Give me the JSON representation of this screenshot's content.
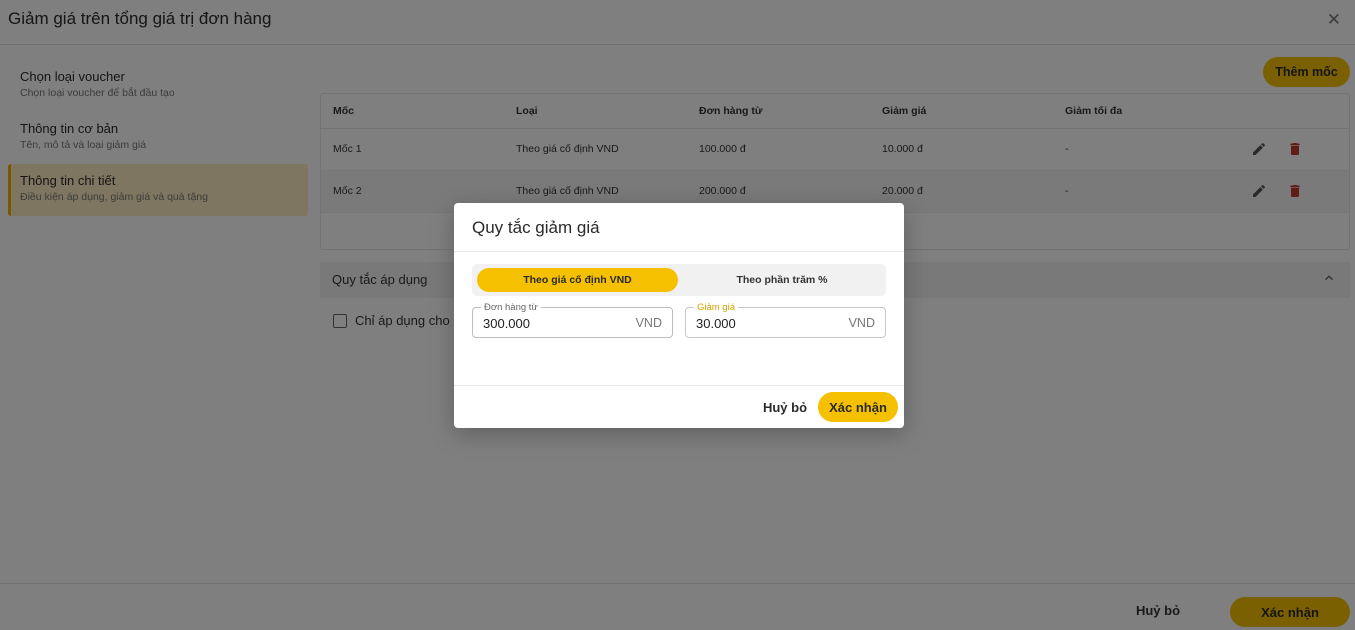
{
  "header": {
    "title": "Giảm giá trên tổng giá trị đơn hàng",
    "close_icon": "close-icon"
  },
  "sidebar": {
    "steps": [
      {
        "title": "Chọn loại voucher",
        "desc": "Chọn loại voucher để bắt đầu tạo",
        "active": false
      },
      {
        "title": "Thông tin cơ bản",
        "desc": "Tên, mô tả và loại giảm giá",
        "active": false
      },
      {
        "title": "Thông tin chi tiết",
        "desc": "Điều kiện áp dụng, giảm giá và quà tặng",
        "active": true
      }
    ]
  },
  "tiers": {
    "add_label": "Thêm mốc",
    "columns": [
      "Mốc",
      "Loại",
      "Đơn hàng từ",
      "Giảm giá",
      "Giảm tối đa"
    ],
    "rows": [
      [
        "Mốc 1",
        "Theo giá cố định VND",
        "100.000 đ",
        "10.000 đ",
        "-"
      ],
      [
        "Mốc 2",
        "Theo giá cố định VND",
        "200.000 đ",
        "20.000 đ",
        "-"
      ]
    ]
  },
  "rules": {
    "title": "Quy tắc áp dụng",
    "checkbox_label": "Chỉ áp dụng cho",
    "checked": false
  },
  "footer": {
    "cancel_label": "Huỷ bỏ",
    "confirm_label": "Xác nhận"
  },
  "modal": {
    "title": "Quy tắc giảm giá",
    "tabs": [
      {
        "label": "Theo giá cố định VND",
        "selected": true
      },
      {
        "label": "Theo phần trăm %",
        "selected": false
      }
    ],
    "fields": [
      {
        "label": "Đơn hàng từ",
        "value": "300.000",
        "unit": "VND"
      },
      {
        "label": "Giảm giá",
        "value": "30.000",
        "unit": "VND"
      }
    ],
    "cancel_label": "Huỷ bỏ",
    "confirm_label": "Xác nhận"
  },
  "colors": {
    "accent": "#f5c000",
    "active_step_bg": "#ffedc2",
    "delete_icon": "#c0392b"
  }
}
